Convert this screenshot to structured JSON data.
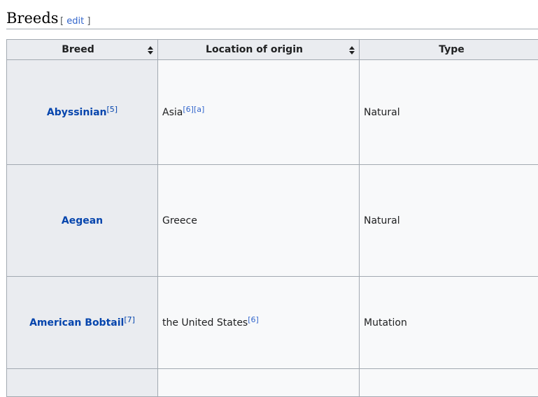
{
  "section": {
    "title": "Breeds",
    "edit_open": "[",
    "edit_label": "edit",
    "edit_close": "]"
  },
  "table": {
    "headers": [
      "Breed",
      "Location of origin",
      "Type"
    ],
    "rows": [
      {
        "breed": "Abyssinian",
        "breed_refs": "[5]",
        "origin": "Asia",
        "origin_refs": [
          "[6]",
          "[a]"
        ],
        "type": "Natural"
      },
      {
        "breed": "Aegean",
        "breed_refs": "",
        "origin": "Greece",
        "origin_refs": [],
        "type": "Natural"
      },
      {
        "breed": "American Bobtail",
        "breed_refs": "[7]",
        "origin": "the United States",
        "origin_refs": [
          "[6]"
        ],
        "type": "Mutation"
      }
    ]
  }
}
